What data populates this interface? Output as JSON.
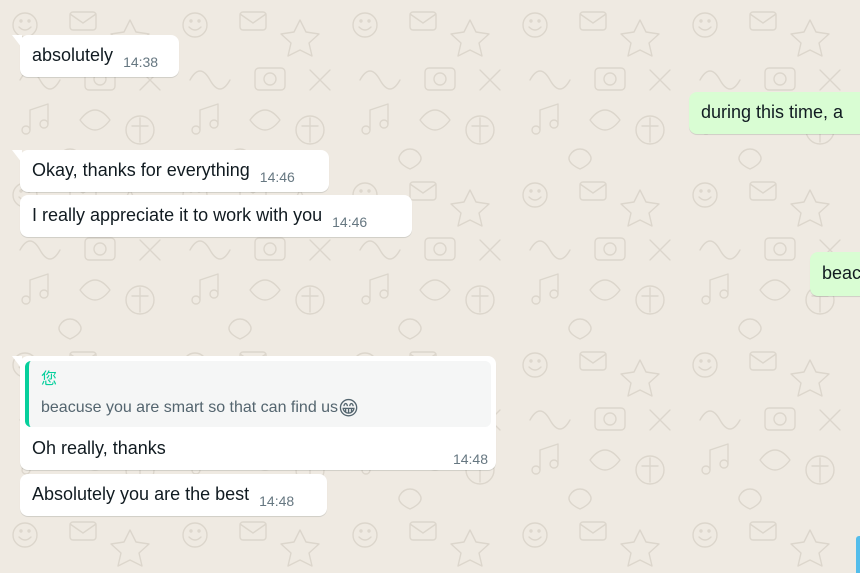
{
  "messages": {
    "m1": {
      "text": "absolutely",
      "time": "14:38"
    },
    "m2": {
      "text": "during this time, a"
    },
    "m3": {
      "text": "Okay, thanks for everything",
      "time": "14:46"
    },
    "m4": {
      "text": "I really appreciate it to work with you",
      "time": "14:46"
    },
    "m5": {
      "text": "beac"
    },
    "m6": {
      "quote_author": "您",
      "quote_text": "beacuse you are smart so that can find us",
      "quote_emoji": "😁",
      "text": "Oh really, thanks",
      "time": "14:48"
    },
    "m7": {
      "text": "Absolutely you are the best",
      "time": "14:48"
    }
  },
  "theme": {
    "wallpaper": "#efeae2",
    "incoming_bubble": "#ffffff",
    "outgoing_bubble": "#d9fdd3",
    "quote_accent": "#06cf9c",
    "timestamp": "#667781",
    "edge_accent": "#53bdeb"
  }
}
